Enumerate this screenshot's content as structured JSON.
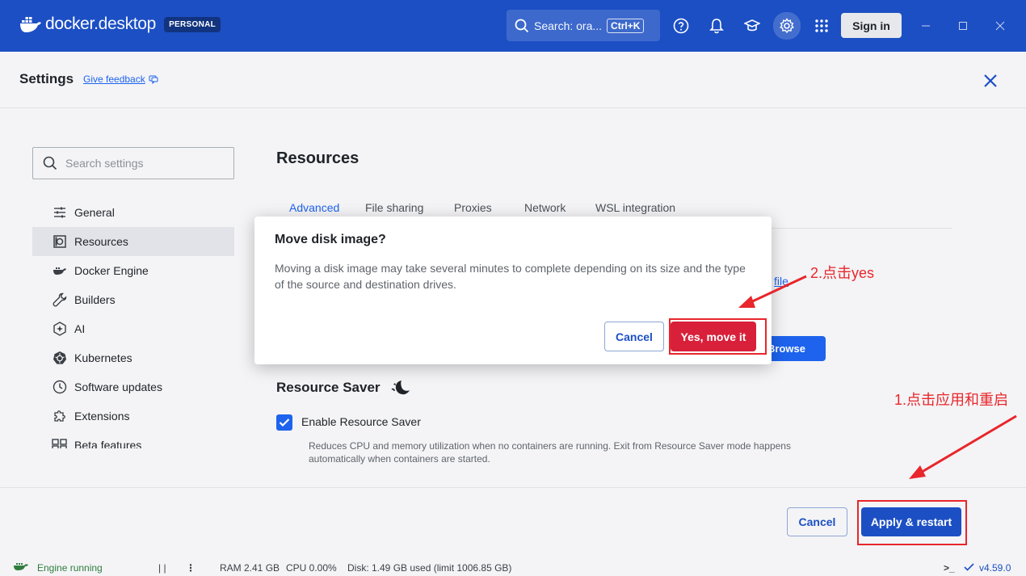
{
  "app": {
    "logo_text_a": "docker",
    "logo_text_b": ".desktop",
    "badge": "PERSONAL",
    "search_text": "Search: ora...",
    "search_shortcut": "Ctrl+K",
    "sign_in": "Sign in"
  },
  "settings": {
    "title": "Settings",
    "feedback": "Give feedback",
    "search_placeholder": "Search settings"
  },
  "sidebar": {
    "items": [
      {
        "label": "General",
        "icon": "sliders-icon"
      },
      {
        "label": "Resources",
        "icon": "disk-icon"
      },
      {
        "label": "Docker Engine",
        "icon": "whale-icon"
      },
      {
        "label": "Builders",
        "icon": "wrench-icon"
      },
      {
        "label": "AI",
        "icon": "ai-icon"
      },
      {
        "label": "Kubernetes",
        "icon": "helm-icon"
      },
      {
        "label": "Software updates",
        "icon": "clock-icon"
      },
      {
        "label": "Extensions",
        "icon": "puzzle-icon"
      },
      {
        "label": "Beta features",
        "icon": "beta-icon"
      }
    ]
  },
  "main": {
    "title": "Resources",
    "tabs": [
      "Advanced",
      "File sharing",
      "Proxies",
      "Network",
      "WSL integration"
    ],
    "file_link": "file",
    "browse": "Browse",
    "resource_saver_title": "Resource Saver",
    "enable_label": "Enable Resource Saver",
    "enable_desc": "Reduces CPU and memory utilization when no containers are running. Exit from Resource Saver mode happens automatically when containers are started."
  },
  "footer": {
    "cancel": "Cancel",
    "apply": "Apply & restart"
  },
  "statusbar": {
    "engine": "Engine running",
    "pause": "| |",
    "more": "⋮",
    "ram": "RAM 2.41 GB",
    "cpu": "CPU 0.00%",
    "disk": "Disk: 1.49 GB used (limit 1006.85 GB)",
    "terminal": ">_",
    "version": "v4.59.0"
  },
  "dialog": {
    "title": "Move disk image?",
    "body": "Moving a disk image may take several minutes to complete depending on its size and the type of the source and destination drives.",
    "cancel": "Cancel",
    "confirm": "Yes, move it"
  },
  "annotations": {
    "step1": "1.点击应用和重启",
    "step2": "2.点击yes"
  },
  "colors": {
    "brand_blue": "#1c4fc4",
    "danger_red": "#d8203a",
    "annotation_red": "#e8262b"
  }
}
